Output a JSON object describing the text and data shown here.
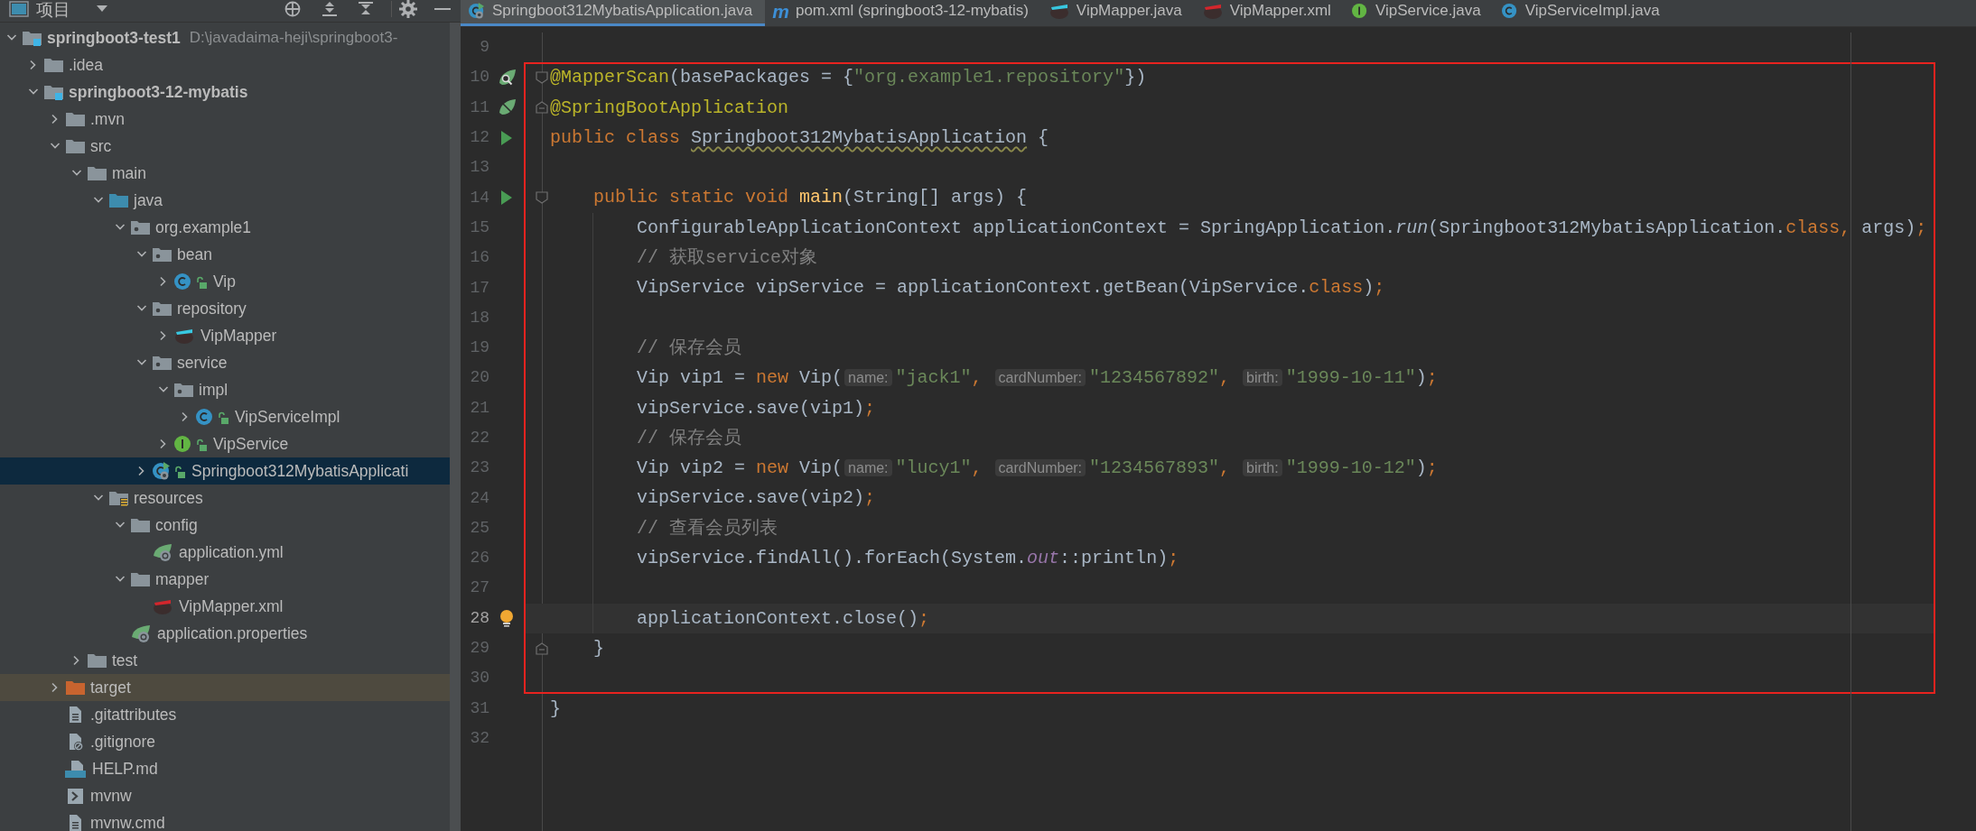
{
  "sidebar": {
    "title": "项目",
    "tree": [
      {
        "label": "springboot3-test1",
        "path": "D:\\javadaima-heji\\springboot3-",
        "kind": "module",
        "expanded": true,
        "selected": false,
        "children": [
          {
            "label": ".idea",
            "kind": "folder",
            "expanded": false,
            "selected": false
          },
          {
            "label": "springboot3-12-mybatis",
            "kind": "module",
            "expanded": true,
            "selected": false,
            "children": [
              {
                "label": ".mvn",
                "kind": "folder",
                "expanded": false,
                "selected": false
              },
              {
                "label": "src",
                "kind": "folder",
                "expanded": true,
                "selected": false,
                "children": [
                  {
                    "label": "main",
                    "kind": "folder",
                    "expanded": true,
                    "selected": false,
                    "children": [
                      {
                        "label": "java",
                        "kind": "source-root",
                        "expanded": true,
                        "selected": false,
                        "children": [
                          {
                            "label": "org.example1",
                            "kind": "package",
                            "expanded": true,
                            "selected": false,
                            "children": [
                              {
                                "label": "bean",
                                "kind": "package",
                                "expanded": true,
                                "selected": false,
                                "children": [
                                  {
                                    "label": "Vip",
                                    "kind": "class",
                                    "expanded": false,
                                    "selected": false
                                  }
                                ]
                              },
                              {
                                "label": "repository",
                                "kind": "package",
                                "expanded": true,
                                "selected": false,
                                "children": [
                                  {
                                    "label": "VipMapper",
                                    "kind": "mapper",
                                    "expanded": false,
                                    "selected": false
                                  }
                                ]
                              },
                              {
                                "label": "service",
                                "kind": "package",
                                "expanded": true,
                                "selected": false,
                                "children": [
                                  {
                                    "label": "impl",
                                    "kind": "package",
                                    "expanded": true,
                                    "selected": false,
                                    "children": [
                                      {
                                        "label": "VipServiceImpl",
                                        "kind": "class",
                                        "expanded": false,
                                        "selected": false
                                      }
                                    ]
                                  },
                                  {
                                    "label": "VipService",
                                    "kind": "interface",
                                    "expanded": false,
                                    "selected": false
                                  }
                                ]
                              },
                              {
                                "label": "Springboot312MybatisApplicati",
                                "kind": "app",
                                "expanded": false,
                                "selected": true
                              }
                            ]
                          }
                        ]
                      },
                      {
                        "label": "resources",
                        "kind": "resources",
                        "expanded": true,
                        "selected": false,
                        "children": [
                          {
                            "label": "config",
                            "kind": "folder",
                            "expanded": true,
                            "selected": false,
                            "children": [
                              {
                                "label": "application.yml",
                                "kind": "spring-config",
                                "selected": false
                              }
                            ]
                          },
                          {
                            "label": "mapper",
                            "kind": "folder",
                            "expanded": true,
                            "selected": false,
                            "children": [
                              {
                                "label": "VipMapper.xml",
                                "kind": "mapper-xml",
                                "selected": false
                              }
                            ]
                          },
                          {
                            "label": "application.properties",
                            "kind": "spring-config",
                            "selected": false
                          }
                        ]
                      }
                    ]
                  },
                  {
                    "label": "test",
                    "kind": "folder",
                    "expanded": false,
                    "selected": false
                  }
                ]
              },
              {
                "label": "target",
                "kind": "excluded",
                "expanded": false,
                "selected": false
              },
              {
                "label": ".gitattributes",
                "kind": "text-file",
                "selected": false
              },
              {
                "label": ".gitignore",
                "kind": "ignore-file",
                "selected": false
              },
              {
                "label": "HELP.md",
                "kind": "markdown",
                "selected": false
              },
              {
                "label": "mvnw",
                "kind": "script",
                "selected": false
              },
              {
                "label": "mvnw.cmd",
                "kind": "text-file",
                "selected": false
              }
            ]
          }
        ]
      }
    ]
  },
  "tabs": [
    {
      "label": "Springboot312MybatisApplication.java",
      "kind": "app",
      "selected": true
    },
    {
      "label": "pom.xml (springboot3-12-mybatis)",
      "kind": "maven",
      "glyph": "m",
      "selected": false
    },
    {
      "label": "VipMapper.java",
      "kind": "mapper",
      "selected": false
    },
    {
      "label": "VipMapper.xml",
      "kind": "mapper-xml",
      "selected": false
    },
    {
      "label": "VipService.java",
      "kind": "interface",
      "selected": false
    },
    {
      "label": "VipServiceImpl.java",
      "kind": "class",
      "selected": false
    }
  ],
  "editor": {
    "lines": [
      {
        "number": "9",
        "framed": false,
        "current": false
      },
      {
        "number": "10",
        "framed": true,
        "current": false,
        "gutter": {
          "kind": "leaf-search"
        },
        "fold": {
          "kind": "start"
        },
        "tokens": [
          {
            "kind": "annotation",
            "t": "@MapperScan"
          },
          {
            "kind": "plain",
            "t": "(basePackages = {"
          },
          {
            "kind": "string",
            "t": "\"org.example1.repository\""
          },
          {
            "kind": "plain",
            "t": "})"
          }
        ]
      },
      {
        "number": "11",
        "framed": true,
        "current": false,
        "gutter": {
          "kind": "leaf"
        },
        "fold": {
          "kind": "end"
        },
        "tokens": [
          {
            "kind": "annotation",
            "t": "@SpringBootApplication"
          }
        ]
      },
      {
        "number": "12",
        "framed": true,
        "current": false,
        "gutter": {
          "kind": "run"
        },
        "tokens": [
          {
            "kind": "keyword",
            "t": "public class "
          },
          {
            "kind": "declaration",
            "t": "Springboot312MybatisApplication"
          },
          {
            "kind": "plain",
            "t": " {"
          }
        ]
      },
      {
        "number": "13",
        "framed": true,
        "current": false
      },
      {
        "number": "14",
        "framed": true,
        "current": false,
        "gutter": {
          "kind": "run"
        },
        "fold": {
          "kind": "start"
        },
        "tokens": [
          {
            "kind": "keyword",
            "t": "    public static void "
          },
          {
            "kind": "method",
            "t": "main"
          },
          {
            "kind": "plain",
            "t": "(String[] args) {"
          }
        ]
      },
      {
        "number": "15",
        "framed": true,
        "current": false,
        "tokens": [
          {
            "kind": "plain",
            "t": "        ConfigurableApplicationContext applicationContext = SpringApplication."
          },
          {
            "kind": "static-call",
            "t": "run"
          },
          {
            "kind": "plain",
            "t": "(Springboot312MybatisApplication."
          },
          {
            "kind": "keyword",
            "t": "class, "
          },
          {
            "kind": "plain",
            "t": "args)"
          },
          {
            "kind": "keyword",
            "t": ";"
          }
        ]
      },
      {
        "number": "16",
        "framed": true,
        "current": false,
        "tokens": [
          {
            "kind": "comment",
            "t": "        // 获取service对象"
          }
        ]
      },
      {
        "number": "17",
        "framed": true,
        "current": false,
        "tokens": [
          {
            "kind": "plain",
            "t": "        VipService vipService = applicationContext.getBean(VipService."
          },
          {
            "kind": "keyword",
            "t": "class"
          },
          {
            "kind": "plain",
            "t": ")"
          },
          {
            "kind": "keyword",
            "t": ";"
          }
        ]
      },
      {
        "number": "18",
        "framed": true,
        "current": false
      },
      {
        "number": "19",
        "framed": true,
        "current": false,
        "tokens": [
          {
            "kind": "comment",
            "t": "        // 保存会员"
          }
        ]
      },
      {
        "number": "20",
        "framed": true,
        "current": false,
        "tokens": [
          {
            "kind": "plain",
            "t": "        Vip vip1 = "
          },
          {
            "kind": "keyword",
            "t": "new "
          },
          {
            "kind": "plain",
            "t": "Vip("
          },
          {
            "kind": "hint",
            "t": "name:"
          },
          {
            "kind": "string",
            "t": "\"jack1\""
          },
          {
            "kind": "keyword",
            "t": ", "
          },
          {
            "kind": "hint",
            "t": "cardNumber:"
          },
          {
            "kind": "string",
            "t": "\"1234567892\""
          },
          {
            "kind": "keyword",
            "t": ", "
          },
          {
            "kind": "hint",
            "t": "birth:"
          },
          {
            "kind": "string",
            "t": "\"1999-10-11\""
          },
          {
            "kind": "plain",
            "t": ")"
          },
          {
            "kind": "keyword",
            "t": ";"
          }
        ]
      },
      {
        "number": "21",
        "framed": true,
        "current": false,
        "tokens": [
          {
            "kind": "plain",
            "t": "        vipService.save(vip1)"
          },
          {
            "kind": "keyword",
            "t": ";"
          }
        ]
      },
      {
        "number": "22",
        "framed": true,
        "current": false,
        "tokens": [
          {
            "kind": "comment",
            "t": "        // 保存会员"
          }
        ]
      },
      {
        "number": "23",
        "framed": true,
        "current": false,
        "tokens": [
          {
            "kind": "plain",
            "t": "        Vip vip2 = "
          },
          {
            "kind": "keyword",
            "t": "new "
          },
          {
            "kind": "plain",
            "t": "Vip("
          },
          {
            "kind": "hint",
            "t": "name:"
          },
          {
            "kind": "string",
            "t": "\"lucy1\""
          },
          {
            "kind": "keyword",
            "t": ", "
          },
          {
            "kind": "hint",
            "t": "cardNumber:"
          },
          {
            "kind": "string",
            "t": "\"1234567893\""
          },
          {
            "kind": "keyword",
            "t": ", "
          },
          {
            "kind": "hint",
            "t": "birth:"
          },
          {
            "kind": "string",
            "t": "\"1999-10-12\""
          },
          {
            "kind": "plain",
            "t": ")"
          },
          {
            "kind": "keyword",
            "t": ";"
          }
        ]
      },
      {
        "number": "24",
        "framed": true,
        "current": false,
        "tokens": [
          {
            "kind": "plain",
            "t": "        vipService.save(vip2)"
          },
          {
            "kind": "keyword",
            "t": ";"
          }
        ]
      },
      {
        "number": "25",
        "framed": true,
        "current": false,
        "tokens": [
          {
            "kind": "comment",
            "t": "        // 查看会员列表"
          }
        ]
      },
      {
        "number": "26",
        "framed": true,
        "current": false,
        "tokens": [
          {
            "kind": "plain",
            "t": "        vipService.findAll().forEach(System."
          },
          {
            "kind": "field",
            "t": "out"
          },
          {
            "kind": "plain",
            "t": "::println)"
          },
          {
            "kind": "keyword",
            "t": ";"
          }
        ]
      },
      {
        "number": "27",
        "framed": true,
        "current": false
      },
      {
        "number": "28",
        "framed": true,
        "current": true,
        "gutter": {
          "kind": "bulb"
        },
        "tokens": [
          {
            "kind": "plain",
            "t": "        applicationContext.close()"
          },
          {
            "kind": "keyword",
            "t": ";"
          }
        ]
      },
      {
        "number": "29",
        "framed": true,
        "current": false,
        "fold": {
          "kind": "end"
        },
        "tokens": [
          {
            "kind": "plain",
            "t": "    }"
          }
        ]
      },
      {
        "number": "30",
        "framed": true,
        "current": false
      },
      {
        "number": "31",
        "framed": false,
        "current": false,
        "tokens": [
          {
            "kind": "plain",
            "t": "}"
          }
        ]
      },
      {
        "number": "32",
        "framed": false,
        "current": false
      }
    ]
  }
}
